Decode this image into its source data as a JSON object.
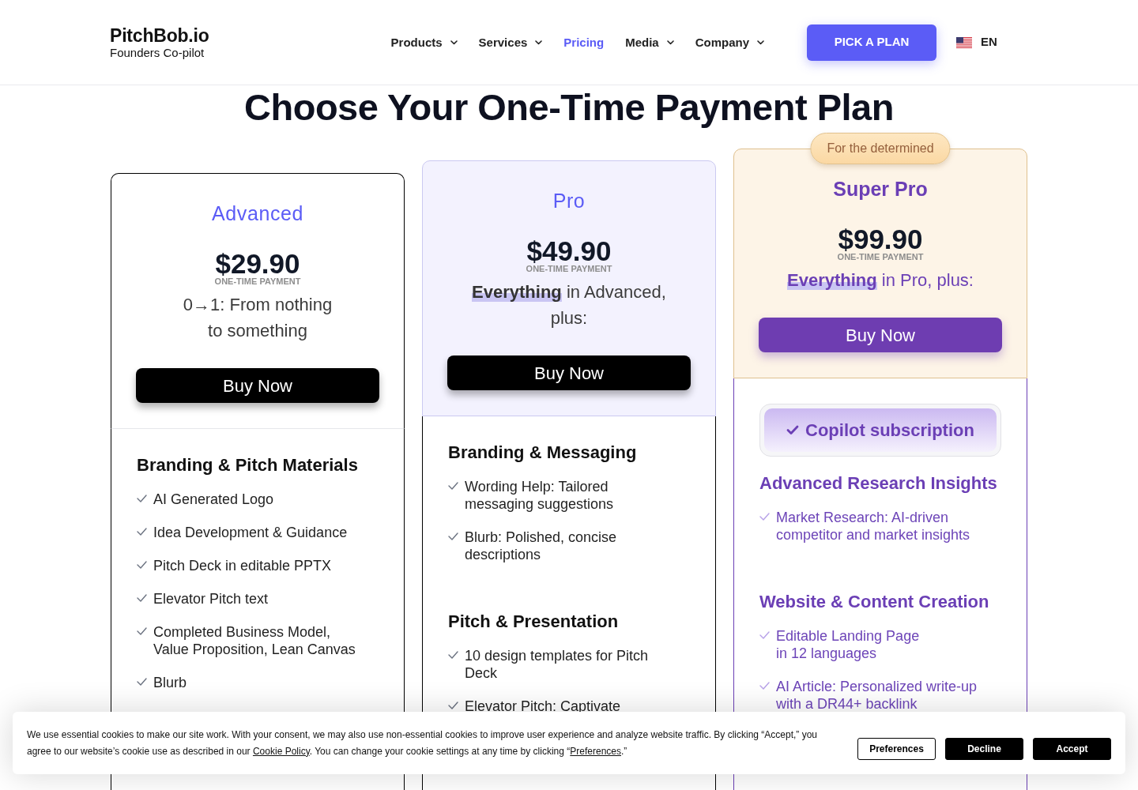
{
  "header": {
    "logo": {
      "name": "PitchBob.io",
      "tagline": "Founders Co-pilot"
    },
    "nav": [
      {
        "label": "Products",
        "selected": false,
        "dropdown": true
      },
      {
        "label": "Services",
        "selected": false,
        "dropdown": true
      },
      {
        "label": "Pricing",
        "selected": true,
        "dropdown": false
      },
      {
        "label": "Media",
        "selected": false,
        "dropdown": true
      },
      {
        "label": "Company",
        "selected": false,
        "dropdown": true
      }
    ],
    "cta": "PICK A PLAN",
    "language": "EN"
  },
  "page_title": "Choose Your One-Time Payment Plan",
  "plans": [
    {
      "kind": "basic",
      "name": "Advanced",
      "price": "$29.90",
      "price_note": "ONE-TIME PAYMENT",
      "summary": "0→1: From nothing\nto something",
      "button": "Buy Now",
      "sections": [
        {
          "heading": "Branding & Pitch Materials",
          "items": [
            "AI Generated Logo",
            "Idea Development & Guidance",
            "Pitch Deck in editable PPTX",
            "Elevator Pitch text",
            "Completed Business Model,\nValue Proposition, Lean Canvas",
            "Blurb"
          ]
        }
      ]
    },
    {
      "kind": "featured",
      "name": "Pro",
      "price": "$49.90",
      "price_note": "ONE-TIME PAYMENT",
      "summary": "**Everything** in Advanced,\nplus:",
      "button": "Buy Now",
      "sections": [
        {
          "heading": "Branding & Messaging",
          "items": [
            "Wording Help: Tailored\nmessaging suggestions",
            "Blurb: Polished, concise\ndescriptions"
          ]
        },
        {
          "heading": "Pitch & Presentation",
          "items": [
            "10 design templates for Pitch\nDeck",
            "Elevator Pitch: Captivate"
          ]
        }
      ]
    },
    {
      "kind": "premium",
      "badge": "For the determined",
      "name": "Super Pro",
      "price": "$99.90",
      "price_note": "ONE-TIME PAYMENT",
      "summary": "**Everything** in Pro, plus:",
      "button": "Buy Now",
      "highlight": "Copilot subscription",
      "sections": [
        {
          "heading": "Advanced Research Insights",
          "items": [
            "Market Research: AI-driven\ncompetitor and market insights"
          ]
        },
        {
          "heading": "Website & Content Creation",
          "items": [
            "Editable Landing Page\nin 12 languages",
            "AI Article: Personalized write-up\nwith a DR44+ backlink"
          ]
        }
      ]
    }
  ],
  "cookie_banner": {
    "message": [
      {
        "kind": "text",
        "text": "We use essential cookies to make our site work. With your consent, we may also use non-essential cookies to improve user experience and analyze website traffic. By clicking “Accept,” you agree to our website’s cookie use as described in our "
      },
      {
        "kind": "link",
        "text": "Cookie Policy"
      },
      {
        "kind": "text",
        "text": ". You can change your cookie settings at any time by clicking “"
      },
      {
        "kind": "link",
        "text": "Preferences"
      },
      {
        "kind": "text",
        "text": ".”"
      }
    ],
    "buttons": [
      {
        "label": "Preferences",
        "kind": "outline"
      },
      {
        "label": "Decline",
        "kind": "solid"
      },
      {
        "label": "Accept",
        "kind": "solid"
      }
    ]
  }
}
